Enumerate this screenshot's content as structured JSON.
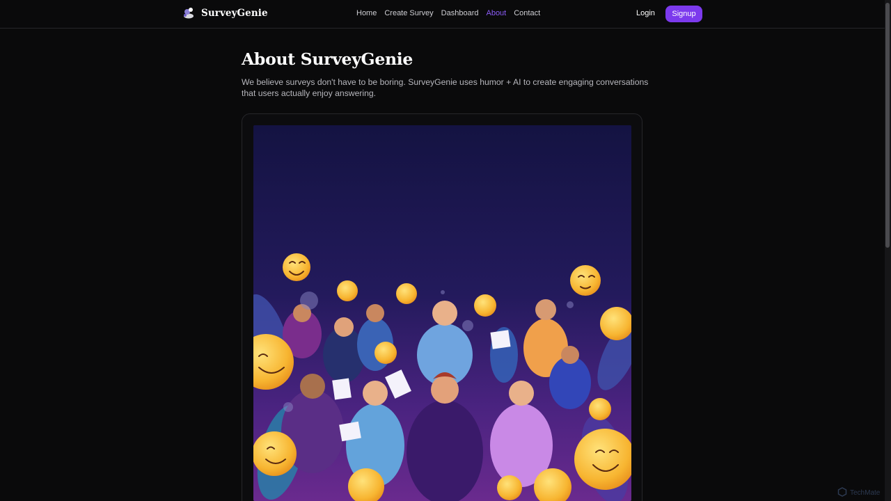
{
  "brand": {
    "name": "SurveyGenie",
    "logo_icon": "genie-lamp-icon"
  },
  "nav": {
    "items": [
      {
        "label": "Home",
        "active": false
      },
      {
        "label": "Create Survey",
        "active": false
      },
      {
        "label": "Dashboard",
        "active": false
      },
      {
        "label": "About",
        "active": true
      },
      {
        "label": "Contact",
        "active": false
      }
    ],
    "login_label": "Login",
    "signup_label": "Signup"
  },
  "about": {
    "title": "About SurveyGenie",
    "description": "We believe surveys don't have to be boring. SurveyGenie uses humor + AI to create engaging conversations that users actually enjoy answering."
  },
  "hero": {
    "image": "illustration of cheerful people holding survey sheets surrounded by laughing emojis"
  },
  "colors": {
    "accent": "#7c3aed",
    "active_nav": "#8b5cf6",
    "background": "#0a0a0b"
  },
  "watermark": {
    "label": "TechMate"
  }
}
